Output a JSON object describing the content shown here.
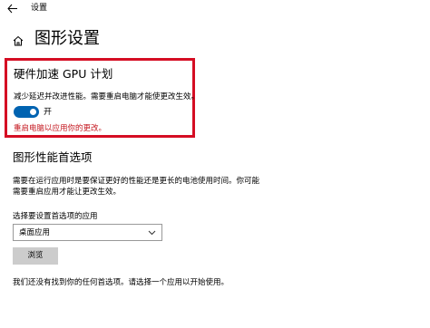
{
  "titlebar": {
    "back_icon": "arrow-left-icon",
    "app_title": "设置"
  },
  "header": {
    "home_icon": "home-icon",
    "title": "图形设置"
  },
  "hardware_acceleration": {
    "heading": "硬件加速 GPU 计划",
    "description": "减少延迟并改进性能。需要重启电脑才能使更改生效。",
    "toggle_state": "on",
    "toggle_label": "开",
    "restart_message": "重启电脑以应用你的更改。",
    "highlight_color": "#d50d23",
    "toggle_color": "#0063b1",
    "restart_message_color": "#c4171f"
  },
  "graphics_preference": {
    "heading": "图形性能首选项",
    "description_lines": [
      "需要在运行应用时是要保证更好的性能还是更长的电池使用时间。你可能",
      "需要重启应用才能让更改生效。"
    ],
    "select_label": "选择要设置首选项的应用",
    "select_value": "桌面应用",
    "select_icon": "chevron-down-icon",
    "browse_label": "浏览",
    "empty_message": "我们还没有找到你的任何首选项。请选择一个应用以开始使用。"
  }
}
